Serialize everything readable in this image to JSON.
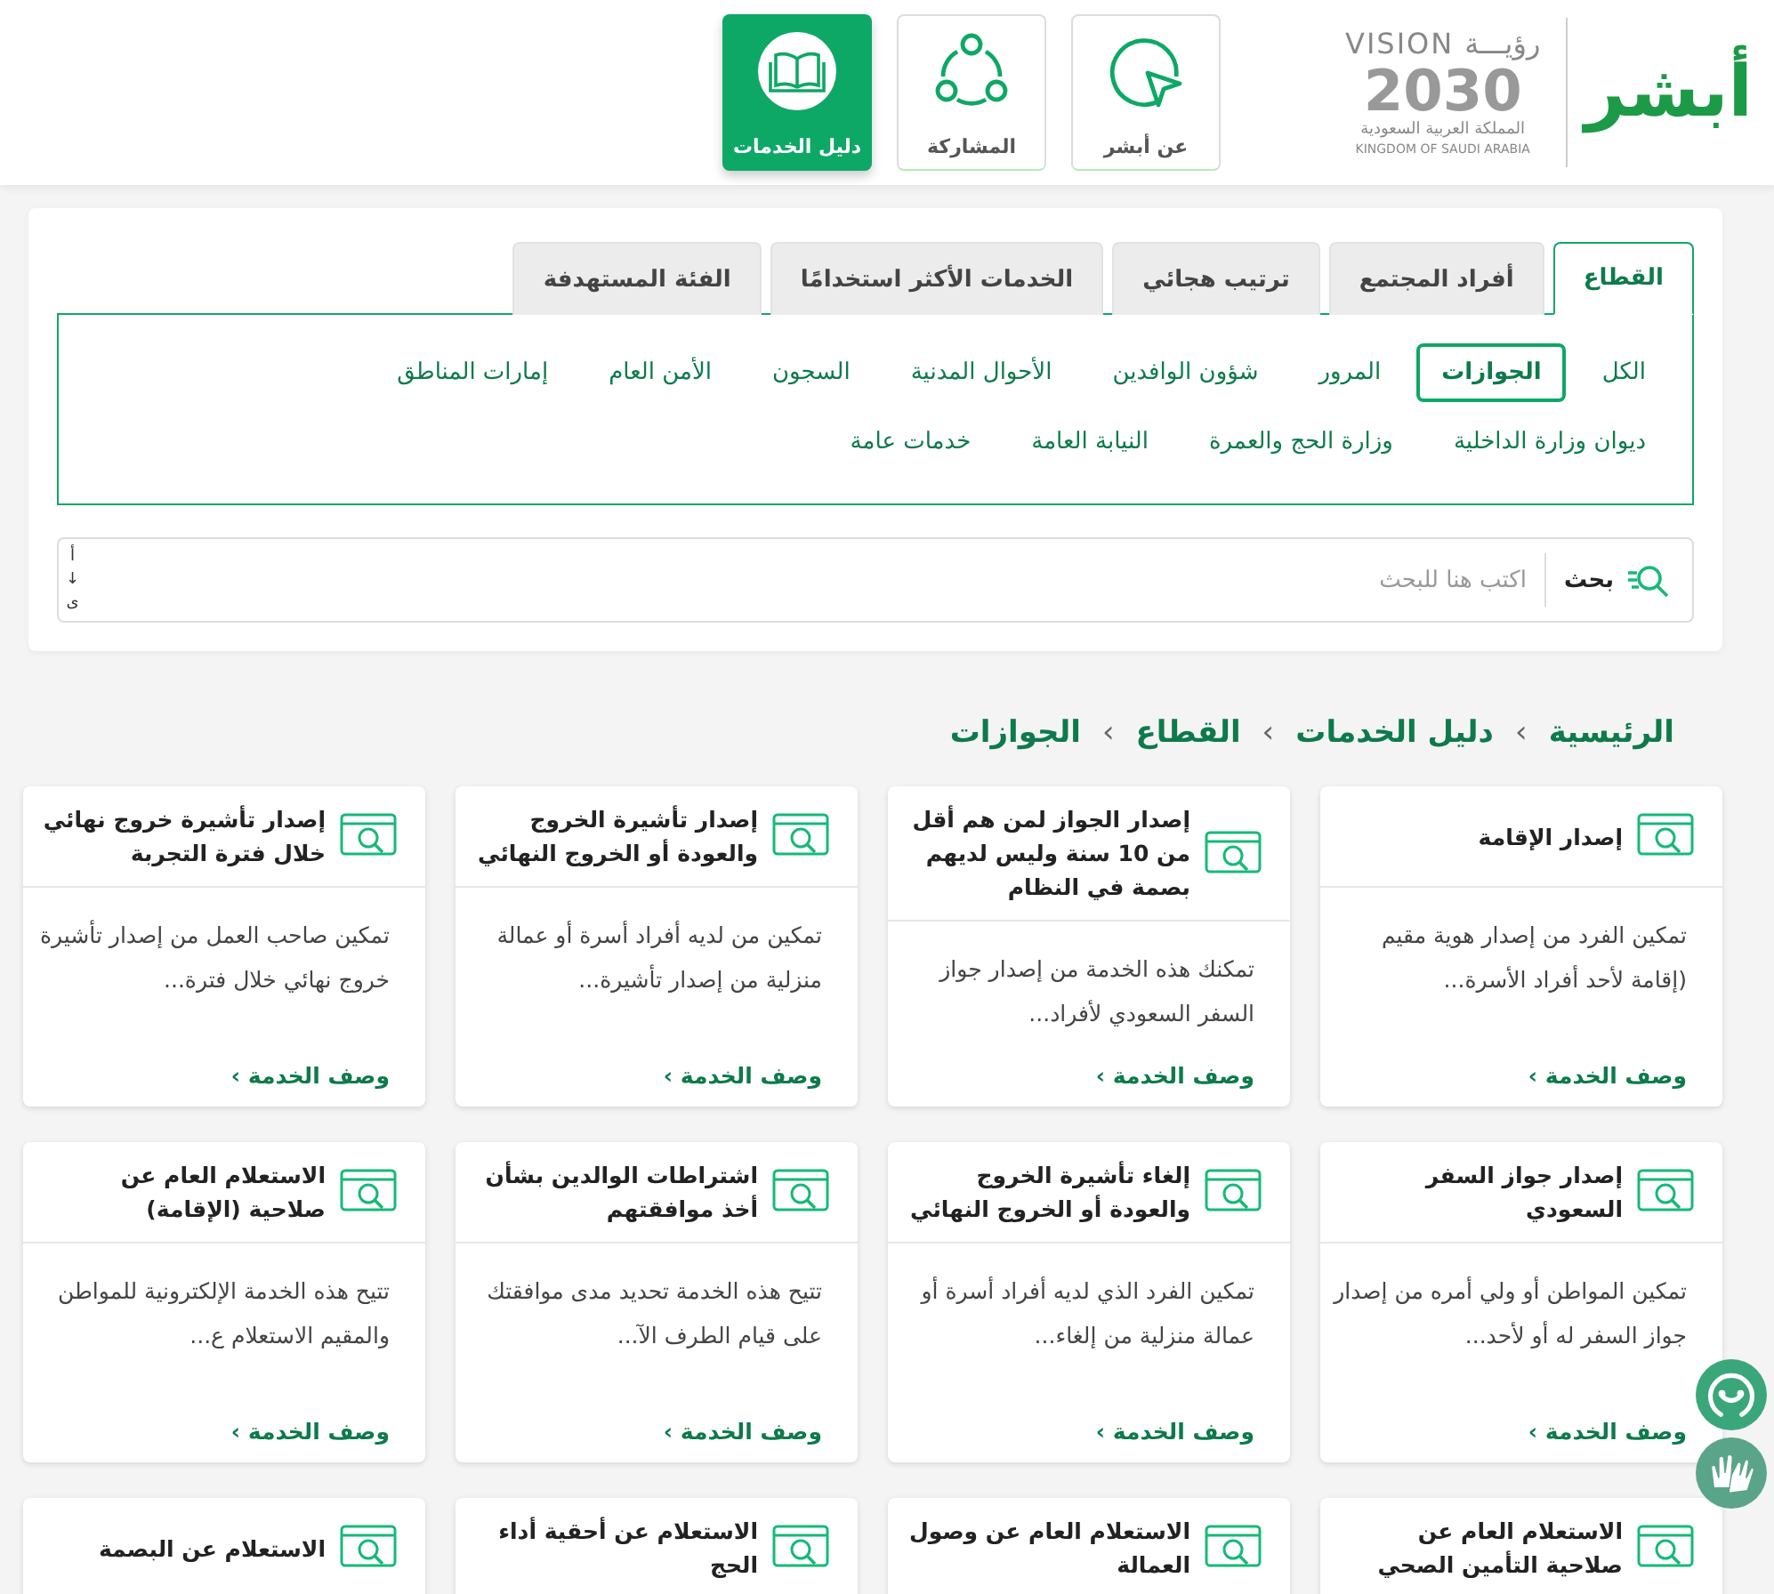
{
  "header": {
    "brand": "أبشر",
    "vision_logo": {
      "word_en": "VISION",
      "word_ar": "رؤيـــة",
      "year": "2030",
      "country_ar": "المملكة العربية السعودية",
      "country_en": "KINGDOM OF SAUDI ARABIA"
    },
    "nav": [
      {
        "label": "عن أبشر",
        "kind": "about",
        "selected": false
      },
      {
        "label": "المشاركة",
        "kind": "share",
        "selected": false
      },
      {
        "label": "دليل الخدمات",
        "kind": "guide",
        "selected": true
      }
    ]
  },
  "tabs": [
    {
      "label": "القطاع",
      "selected": true
    },
    {
      "label": "أفراد المجتمع",
      "selected": false
    },
    {
      "label": "ترتيب هجائي",
      "selected": false
    },
    {
      "label": "الخدمات الأكثر استخدامًا",
      "selected": false
    },
    {
      "label": "الفئة المستهدفة",
      "selected": false
    }
  ],
  "sector_rows": [
    [
      {
        "label": "الكل",
        "selected": false
      },
      {
        "label": "الجوازات",
        "selected": true
      },
      {
        "label": "المرور",
        "selected": false
      },
      {
        "label": "شؤون الوافدين",
        "selected": false
      },
      {
        "label": "الأحوال المدنية",
        "selected": false
      },
      {
        "label": "السجون",
        "selected": false
      },
      {
        "label": "الأمن العام",
        "selected": false
      },
      {
        "label": "إمارات المناطق",
        "selected": false
      }
    ],
    [
      {
        "label": "ديوان وزارة الداخلية",
        "selected": false
      },
      {
        "label": "وزارة الحج والعمرة",
        "selected": false
      },
      {
        "label": "النيابة العامة",
        "selected": false
      },
      {
        "label": "خدمات عامة",
        "selected": false
      }
    ]
  ],
  "search": {
    "label": "بحث",
    "placeholder": "اكتب هنا للبحث",
    "sort_toggle": {
      "from": "أ",
      "arrow": "↓",
      "to": "ى"
    }
  },
  "breadcrumb": {
    "items": [
      "الرئيسية",
      "دليل الخدمات",
      "القطاع",
      "الجوازات"
    ],
    "separator": "›"
  },
  "cards": [
    {
      "title": "إصدار الإقامة",
      "description": "تمكين الفرد من إصدار هوية مقيم (إقامة لأحد أفراد الأسرة...",
      "link": "وصف الخدمة ›"
    },
    {
      "title": "إصدار الجواز لمن هم أقل من 10 سنة وليس لديهم بصمة في النظام",
      "description": "تمكنك هذه الخدمة من إصدار جواز السفر السعودي لأفراد...",
      "link": "وصف الخدمة ›"
    },
    {
      "title": "إصدار تأشيرة الخروج والعودة أو الخروج النهائي",
      "description": "تمكين من لديه أفراد أسرة أو عمالة منزلية من إصدار تأشيرة...",
      "link": "وصف الخدمة ›"
    },
    {
      "title": "إصدار تأشيرة خروج نهائي خلال فترة التجربة",
      "description": "تمكين صاحب العمل من إصدار تأشيرة خروج نهائي خلال فترة...",
      "link": "وصف الخدمة ›"
    },
    {
      "title": "إصدار جواز السفر السعودي",
      "description": "تمكين المواطن أو ولي أمره من إصدار جواز السفر له أو لأحد...",
      "link": "وصف الخدمة ›"
    },
    {
      "title": "إلغاء تأشيرة الخروج والعودة أو الخروج النهائي",
      "description": "تمكين الفرد الذي لديه أفراد أسرة أو عمالة منزلية من إلغاء...",
      "link": "وصف الخدمة ›"
    },
    {
      "title": "اشتراطات الوالدين بشأن أخذ موافقتهم",
      "description": "تتيح هذه الخدمة تحديد مدى موافقتك على قيام الطرف الآ...",
      "link": "وصف الخدمة ›"
    },
    {
      "title": "الاستعلام العام عن صلاحية (الإقامة)",
      "description": "تتيح هذه الخدمة الإلكترونية للمواطن والمقيم الاستعلام ع...",
      "link": "وصف الخدمة ›"
    },
    {
      "title": "الاستعلام العام عن صلاحية التأمين الصحي"
    },
    {
      "title": "الاستعلام العام عن وصول العمالة"
    },
    {
      "title": "الاستعلام عن أحقية أداء الحج"
    },
    {
      "title": "الاستعلام عن البصمة"
    }
  ]
}
